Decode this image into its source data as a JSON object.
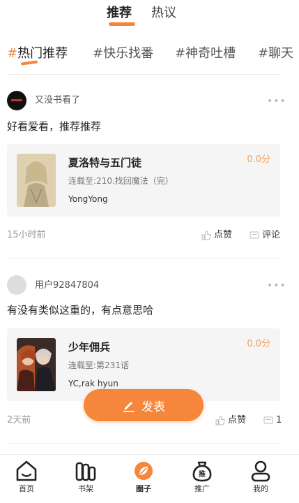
{
  "top_tabs": [
    {
      "label": "推荐",
      "active": true
    },
    {
      "label": "热议",
      "active": false
    }
  ],
  "categories": [
    {
      "hash": "#",
      "label": "热门推荐",
      "active": true
    },
    {
      "hash": "#",
      "label": "快乐找番",
      "active": false
    },
    {
      "hash": "#",
      "label": "神奇吐槽",
      "active": false
    },
    {
      "hash": "#",
      "label": "聊天",
      "active": false
    }
  ],
  "posts": [
    {
      "username": "又没书看了",
      "avatar": "dark-avatar",
      "more": "•••",
      "text": "好看爱看，推荐推荐",
      "book": {
        "title": "夏洛特与五门徒",
        "episode": "连载至:210.找回魔法（完）",
        "author": "YongYong",
        "score": "0.0分"
      },
      "time": "15小时前",
      "like_label": "点赞",
      "comment_label": "评论"
    },
    {
      "username": "用户92847804",
      "avatar": "gray-avatar",
      "more": "•••",
      "text": "有没有类似这重的，有点意思哈",
      "book": {
        "title": "少年佣兵",
        "episode": "连载至:第231话",
        "author": "YC,rak hyun",
        "score": "0.0分"
      },
      "time": "2天前",
      "like_label": "点赞",
      "comment_label": "1"
    }
  ],
  "fab": {
    "label": "发表",
    "icon": "pen-icon"
  },
  "bottom_nav": [
    {
      "label": "首页",
      "icon": "home-icon",
      "active": false
    },
    {
      "label": "书架",
      "icon": "bookshelf-icon",
      "active": false
    },
    {
      "label": "圈子",
      "icon": "circle-leaf-icon",
      "active": true
    },
    {
      "label": "推广",
      "icon": "promote-bag-icon",
      "active": false,
      "icon_text": "推"
    },
    {
      "label": "我的",
      "icon": "profile-icon",
      "active": false
    }
  ],
  "colors": {
    "accent": "#f5863b",
    "score": "#f5a05a"
  }
}
